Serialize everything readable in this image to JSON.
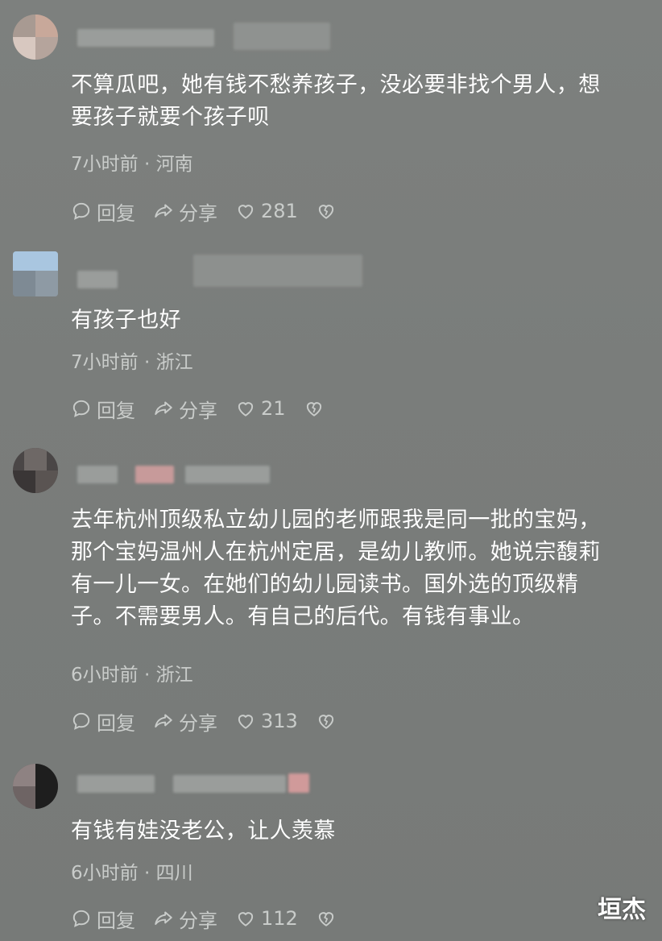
{
  "comments": [
    {
      "text_lines": [
        "不算瓜吧，她有钱不愁养孩子，没必要非找个男人，想",
        "要孩子就要个孩子呗"
      ],
      "time": "7小时前",
      "sep": "·",
      "location": "河南",
      "reply_label": "回复",
      "share_label": "分享",
      "likes": "281"
    },
    {
      "text_lines": [
        "有孩子也好"
      ],
      "time": "7小时前",
      "sep": "·",
      "location": "浙江",
      "reply_label": "回复",
      "share_label": "分享",
      "likes": "21"
    },
    {
      "text_lines": [
        "去年杭州顶级私立幼儿园的老师跟我是同一批的宝妈，",
        "那个宝妈温州人在杭州定居，是幼儿教师。她说宗馥莉",
        "有一儿一女。在她们的幼儿园读书。国外选的顶级精",
        "子。不需要男人。有自己的后代。有钱有事业。"
      ],
      "time": "6小时前",
      "sep": "·",
      "location": "浙江",
      "reply_label": "回复",
      "share_label": "分享",
      "likes": "313"
    },
    {
      "text_lines": [
        "有钱有娃没老公，让人羡慕"
      ],
      "time": "6小时前",
      "sep": "·",
      "location": "四川",
      "reply_label": "回复",
      "share_label": "分享",
      "likes": "112"
    }
  ],
  "watermark": "垣杰",
  "colors": {
    "background": "#7b7e7c",
    "text": "#ffffff",
    "meta": "#c9ccca"
  },
  "icons": [
    "comment-bubble-icon",
    "share-arrow-icon",
    "heart-icon",
    "broken-heart-icon"
  ]
}
